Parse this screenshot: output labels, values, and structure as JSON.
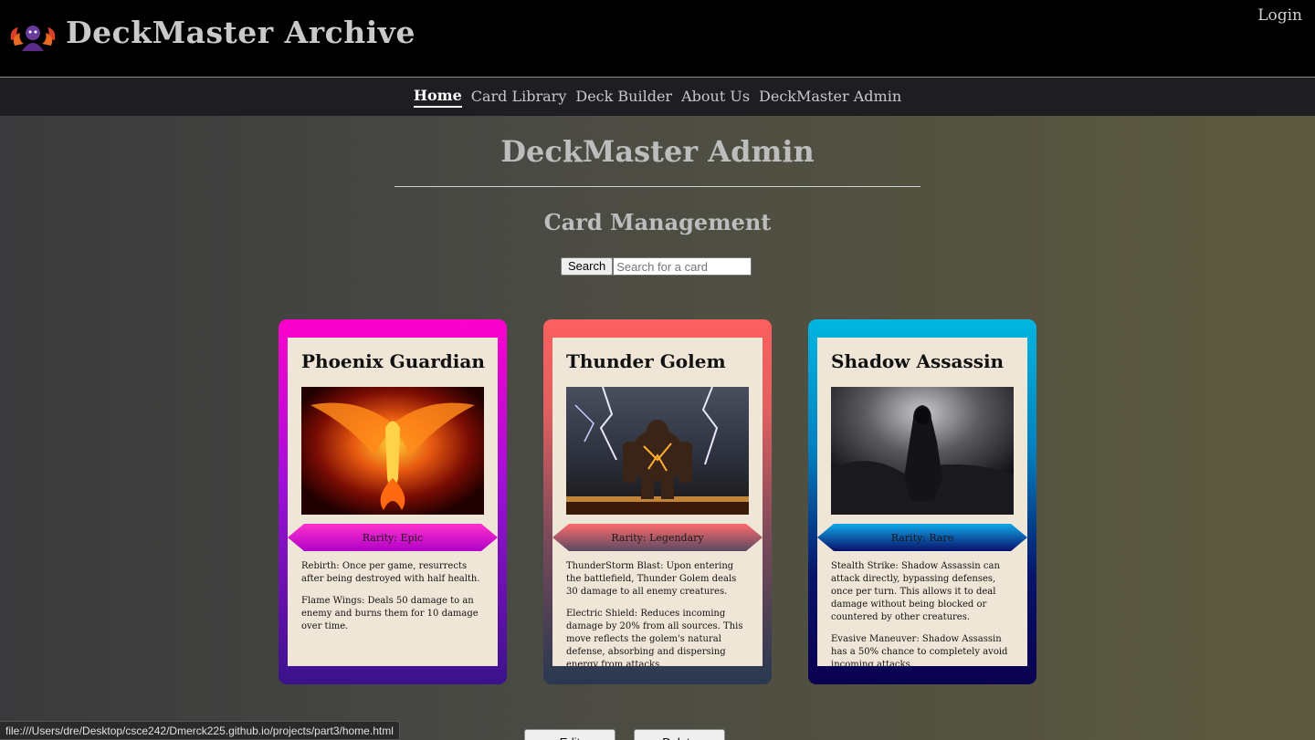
{
  "header": {
    "site_title": "DeckMaster Archive",
    "login_label": "Login"
  },
  "nav": {
    "items": [
      {
        "label": "Home",
        "active": true
      },
      {
        "label": "Card Library"
      },
      {
        "label": "Deck Builder"
      },
      {
        "label": "About Us"
      },
      {
        "label": "DeckMaster Admin"
      }
    ]
  },
  "main": {
    "page_title": "DeckMaster Admin",
    "section_title": "Card Management",
    "search": {
      "button_label": "Search",
      "placeholder": "Search for a card",
      "value": ""
    },
    "cards": [
      {
        "name": "Phoenix Guardian",
        "rarity": "Rarity: Epic",
        "abilities": [
          "Rebirth: Once per game, resurrects after being destroyed with half health.",
          "Flame Wings: Deals 50 damage to an enemy and burns them for 10 damage over time."
        ]
      },
      {
        "name": "Thunder Golem",
        "rarity": "Rarity: Legendary",
        "abilities": [
          "ThunderStorm Blast: Upon entering the battlefield, Thunder Golem deals 30 damage to all enemy creatures.",
          "Electric Shield: Reduces incoming damage by 20% from all sources. This move reflects the golem's natural defense, absorbing and dispersing energy from attacks."
        ]
      },
      {
        "name": "Shadow Assassin",
        "rarity": "Rarity: Rare",
        "abilities": [
          "Stealth Strike: Shadow Assassin can attack directly, bypassing defenses, once per turn. This allows it to deal damage without being blocked or countered by other creatures.",
          "Evasive Maneuver: Shadow Assassin has a 50% chance to completely avoid incoming attacks."
        ]
      }
    ],
    "edit_label": "Edit",
    "delete_label": "Delete"
  },
  "status_bar": {
    "url": "file:///Users/dre/Desktop/csce242/Dmerck225.github.io/projects/part3/home.html"
  }
}
